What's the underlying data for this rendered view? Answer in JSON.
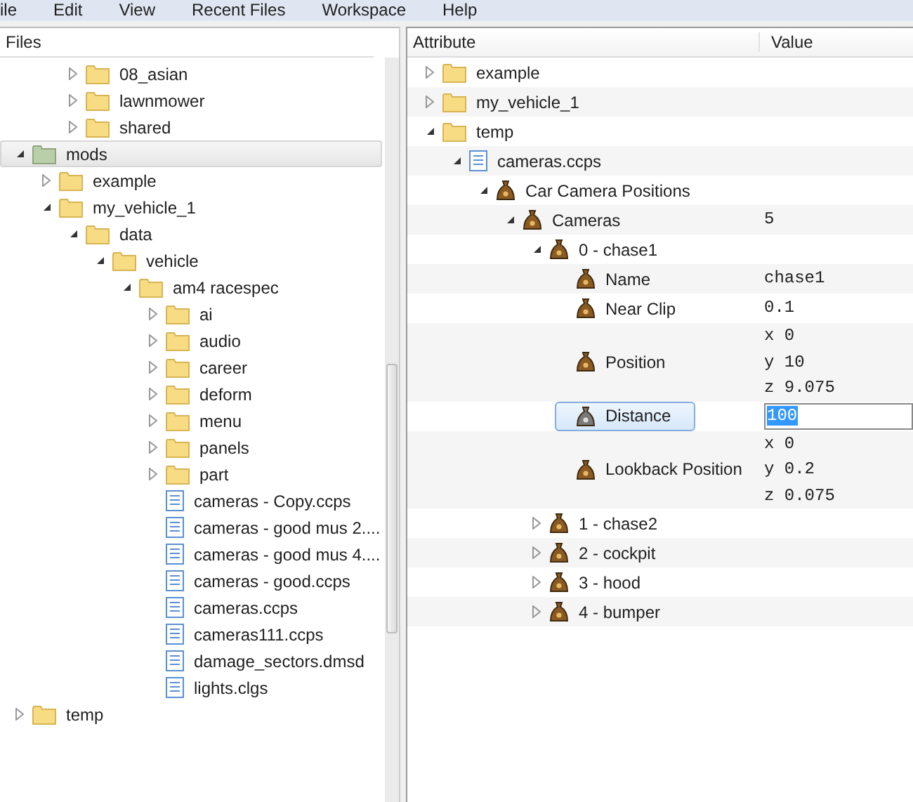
{
  "menu": [
    "ile",
    "Edit",
    "View",
    "Recent Files",
    "Workspace",
    "Help"
  ],
  "files": {
    "title": "Files",
    "continued_items": [
      {
        "label": "08_asian",
        "kind": "folder",
        "expanded": false,
        "selected": false
      },
      {
        "label": "lawnmower",
        "kind": "folder",
        "expanded": false,
        "selected": false
      },
      {
        "label": "shared",
        "kind": "folder",
        "expanded": false,
        "selected": false
      }
    ],
    "items": [
      {
        "label": "mods",
        "kind": "mod-folder",
        "expanded": true,
        "selected": true,
        "children": [
          {
            "label": "example",
            "kind": "folder",
            "expanded": false,
            "selected": false
          },
          {
            "label": "my_vehicle_1",
            "kind": "folder",
            "expanded": true,
            "selected": false,
            "children": [
              {
                "label": "data",
                "kind": "folder",
                "expanded": true,
                "selected": false,
                "children": [
                  {
                    "label": "vehicle",
                    "kind": "folder",
                    "expanded": true,
                    "selected": false,
                    "children": [
                      {
                        "label": "am4 racespec",
                        "kind": "folder",
                        "expanded": true,
                        "selected": false,
                        "children": [
                          {
                            "label": "ai",
                            "kind": "folder",
                            "expanded": false,
                            "selected": false
                          },
                          {
                            "label": "audio",
                            "kind": "folder",
                            "expanded": false,
                            "selected": false
                          },
                          {
                            "label": "career",
                            "kind": "folder",
                            "expanded": false,
                            "selected": false
                          },
                          {
                            "label": "deform",
                            "kind": "folder",
                            "expanded": false,
                            "selected": false
                          },
                          {
                            "label": "menu",
                            "kind": "folder",
                            "expanded": false,
                            "selected": false
                          },
                          {
                            "label": "panels",
                            "kind": "folder",
                            "expanded": false,
                            "selected": false
                          },
                          {
                            "label": "part",
                            "kind": "folder",
                            "expanded": false,
                            "selected": false
                          },
                          {
                            "label": "cameras - Copy.ccps",
                            "kind": "file",
                            "selected": false
                          },
                          {
                            "label": "cameras - good mus 2....",
                            "kind": "file",
                            "selected": false
                          },
                          {
                            "label": "cameras - good mus 4....",
                            "kind": "file",
                            "selected": false
                          },
                          {
                            "label": "cameras - good.ccps",
                            "kind": "file",
                            "selected": false
                          },
                          {
                            "label": "cameras.ccps",
                            "kind": "file",
                            "selected": false
                          },
                          {
                            "label": "cameras111.ccps",
                            "kind": "file",
                            "selected": false
                          },
                          {
                            "label": "damage_sectors.dmsd",
                            "kind": "file",
                            "selected": false
                          },
                          {
                            "label": "lights.clgs",
                            "kind": "file",
                            "selected": false
                          }
                        ]
                      }
                    ]
                  }
                ]
              }
            ]
          }
        ]
      },
      {
        "label": "temp",
        "kind": "folder",
        "expanded": false,
        "selected": false
      }
    ]
  },
  "attributes": {
    "columns": [
      "Attribute",
      "Value"
    ],
    "items": [
      {
        "label": "example",
        "kind": "folder",
        "expanded": false,
        "selected": false
      },
      {
        "label": "my_vehicle_1",
        "kind": "folder",
        "expanded": false,
        "selected": false
      },
      {
        "label": "temp",
        "kind": "folder",
        "expanded": true,
        "selected": false,
        "children": [
          {
            "label": "cameras.ccps",
            "kind": "file",
            "expanded": true,
            "selected": false,
            "children": [
              {
                "label": "Car Camera Positions",
                "kind": "property",
                "expanded": true,
                "selected": false,
                "children": [
                  {
                    "label": "Cameras",
                    "kind": "property",
                    "expanded": true,
                    "selected": false,
                    "value": [
                      "5"
                    ],
                    "children": [
                      {
                        "label": "0 - chase1",
                        "kind": "property",
                        "expanded": true,
                        "selected": false,
                        "children": [
                          {
                            "label": "Name",
                            "kind": "property",
                            "selected": false,
                            "value": [
                              "chase1"
                            ]
                          },
                          {
                            "label": "Near Clip",
                            "kind": "property",
                            "selected": false,
                            "value": [
                              "0.1"
                            ]
                          },
                          {
                            "label": "Position",
                            "kind": "property",
                            "selected": false,
                            "value": [
                              "x 0",
                              "y 10",
                              "z 9.075"
                            ]
                          },
                          {
                            "label": "Distance",
                            "kind": "property",
                            "selected": true,
                            "value": [
                              "100"
                            ]
                          },
                          {
                            "label": "Lookback Position",
                            "kind": "property",
                            "selected": false,
                            "value": [
                              "x 0",
                              "y 0.2",
                              "z 0.075"
                            ]
                          }
                        ]
                      },
                      {
                        "label": "1 - chase2",
                        "kind": "property",
                        "expanded": false,
                        "selected": false
                      },
                      {
                        "label": "2 - cockpit",
                        "kind": "property",
                        "expanded": false,
                        "selected": false
                      },
                      {
                        "label": "3 - hood",
                        "kind": "property",
                        "expanded": false,
                        "selected": false
                      },
                      {
                        "label": "4 - bumper",
                        "kind": "property",
                        "expanded": false,
                        "selected": false
                      }
                    ]
                  }
                ]
              }
            ]
          }
        ]
      }
    ]
  }
}
